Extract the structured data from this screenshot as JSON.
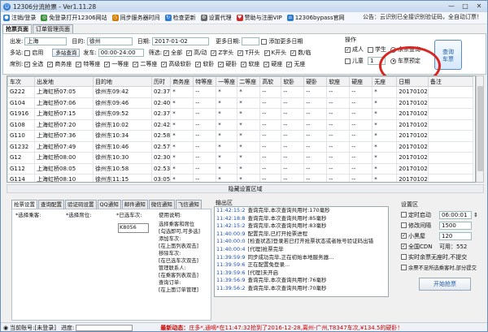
{
  "window": {
    "title": "12306分流抢票 - Ver1.11.28",
    "minimize": "—",
    "maximize": "□",
    "close": "✕"
  },
  "toolbar": {
    "items": [
      {
        "label": "注销/登录",
        "icon": "user-icon",
        "color": "#2b7bd0"
      },
      {
        "label": "免登录打开12306网站",
        "icon": "globe-icon",
        "color": "#3a8a3a"
      },
      {
        "label": "同步服务器时间",
        "icon": "clock-icon",
        "color": "#d07a00"
      },
      {
        "label": "检查更新",
        "icon": "update-icon",
        "color": "#2b7bd0"
      },
      {
        "label": "设置代理",
        "icon": "gear-icon",
        "color": "#666666"
      },
      {
        "label": "赞助与注册VIP",
        "icon": "heart-icon",
        "color": "#d02a2a"
      },
      {
        "label": "12306bypass官网",
        "icon": "home-icon",
        "color": "#2b7bd0"
      }
    ],
    "notice": "公告：云识别已全接识别验证码，全自动订票！"
  },
  "tabs": [
    {
      "label": "抢票页面"
    },
    {
      "label": "订单管理页面"
    }
  ],
  "search": {
    "from_label": "出发:",
    "from_value": "上海",
    "to_label": "目的:",
    "to_value": "徐州",
    "date_label": "日期:",
    "date_value": "2017-01-02",
    "more_dates_label": "更多日期:",
    "add_more_dates_label": "添加更多日期",
    "multistation_label": "多站:",
    "multistation_enable": "启用",
    "multistation_button": "多站查询",
    "depart_label": "发车:",
    "depart_value": "00:00-24:00",
    "filter_label": "筛选:",
    "filters": [
      {
        "label": "全部",
        "checked": true
      },
      {
        "label": "高/动",
        "checked": true
      },
      {
        "label": "Z字头",
        "checked": true
      },
      {
        "label": "T开头",
        "checked": true
      },
      {
        "label": "K开头",
        "checked": true
      },
      {
        "label": "数/临",
        "checked": true
      }
    ],
    "seat_label": "席别:",
    "seats": [
      {
        "label": "全选",
        "checked": true
      },
      {
        "label": "商务座",
        "checked": true
      },
      {
        "label": "特等座",
        "checked": true
      },
      {
        "label": "一等座",
        "checked": true
      },
      {
        "label": "二等座",
        "checked": true
      },
      {
        "label": "高级软卧",
        "checked": true
      },
      {
        "label": "软卧",
        "checked": true
      },
      {
        "label": "硬卧",
        "checked": true
      },
      {
        "label": "软座",
        "checked": true
      },
      {
        "label": "硬座",
        "checked": true
      },
      {
        "label": "无座",
        "checked": true
      }
    ]
  },
  "operation": {
    "label": "操作",
    "adult": "成人",
    "student": "学生",
    "child": "儿童",
    "child_count": "1",
    "remain_query": "余票查询",
    "schedule_booking": "车票预定",
    "query_button": "查询\n车票"
  },
  "table": {
    "headers": [
      "车次",
      "出发地",
      "目的地",
      "历时",
      "商务座",
      "特等座",
      "一等座",
      "二等座",
      "高软",
      "软卧",
      "硬卧",
      "软座",
      "硬座",
      "无座",
      "日期",
      "备注"
    ],
    "rows": [
      [
        "G222",
        "上海虹桥07:05",
        "徐州东09:42",
        "02:37",
        "*",
        "--",
        "*",
        "*",
        "--",
        "--",
        "--",
        "--",
        "--",
        "*",
        "20170102",
        ""
      ],
      [
        "G104",
        "上海虹桥07:06",
        "徐州东09:46",
        "02:40",
        "*",
        "--",
        "*",
        "*",
        "--",
        "--",
        "--",
        "--",
        "--",
        "*",
        "20170102",
        ""
      ],
      [
        "G1916",
        "上海虹桥07:15",
        "徐州东09:52",
        "02:37",
        "*",
        "--",
        "*",
        "*",
        "--",
        "--",
        "--",
        "--",
        "--",
        "*",
        "20170102",
        ""
      ],
      [
        "G108",
        "上海虹桥07:20",
        "徐州东10:02",
        "02:42",
        "*",
        "--",
        "*",
        "*",
        "--",
        "--",
        "--",
        "--",
        "--",
        "*",
        "20170102",
        ""
      ],
      [
        "G110",
        "上海虹桥07:36",
        "徐州东10:34",
        "02:58",
        "*",
        "--",
        "*",
        "*",
        "--",
        "--",
        "--",
        "--",
        "--",
        "*",
        "20170102",
        ""
      ],
      [
        "G1232",
        "上海虹桥07:49",
        "徐州东10:46",
        "02:57",
        "*",
        "--",
        "*",
        "*",
        "--",
        "--",
        "--",
        "--",
        "--",
        "*",
        "20170102",
        ""
      ],
      [
        "G12",
        "上海虹桥08:00",
        "徐州东10:30",
        "02:30",
        "*",
        "--",
        "*",
        "*",
        "--",
        "--",
        "--",
        "--",
        "--",
        "*",
        "20170102",
        ""
      ],
      [
        "G112",
        "上海虹桥08:05",
        "徐州东10:58",
        "02:53",
        "*",
        "--",
        "*",
        "*",
        "--",
        "--",
        "--",
        "--",
        "--",
        "*",
        "20170102",
        ""
      ],
      [
        "G114",
        "上海虹桥08:10",
        "徐州东11:15",
        "03:05",
        "*",
        "--",
        "*",
        "*",
        "--",
        "--",
        "--",
        "--",
        "--",
        "*",
        "20170102",
        ""
      ]
    ]
  },
  "hide_settings": "隐藏设置区域",
  "bottom_tabs": [
    {
      "label": "抢票设置"
    },
    {
      "label": "查询配置"
    },
    {
      "label": "验证码设置"
    },
    {
      "label": "QQ通知"
    },
    {
      "label": "邮件通知"
    },
    {
      "label": "微信通知"
    },
    {
      "label": "飞信通知"
    }
  ],
  "booking": {
    "passenger_label": "*选择乘客:",
    "seat_label": "*选择席位:",
    "train_label": "*已选车次:",
    "train_value": "K8056",
    "usage_label": "使用说明:",
    "usage_lines": [
      "选择乘客和席位",
      "[勾选即可,可多选]",
      "添加车次:",
      "[在上面列表双击]",
      "移除车次:",
      "[在已选车次双击]",
      "管理联系人:",
      "[在乘客列表双击]",
      "查询订单:",
      "[在上面订单管理]"
    ]
  },
  "output": {
    "label": "输出区",
    "lines": [
      {
        "time": "11:42:15:2",
        "text": "查询完毕,本次查询共用时:170毫秒"
      },
      {
        "time": "11:42:18:8",
        "text": "查询完毕,本次查询共用时:85毫秒"
      },
      {
        "time": "11:42:15:2",
        "text": "查询完毕,本次查询共用时:83毫秒"
      },
      {
        "time": "11:40:00:9",
        "text": "配置完毕,已打开抢票进程"
      },
      {
        "time": "11:40:00:0",
        "text": "[检查状态]登录若已打开抢票状态或者账号验证码出错"
      },
      {
        "time": "11:40:00:4",
        "text": "[代理]抢票完毕"
      },
      {
        "time": "11:39:59:9",
        "text": "同步成功完毕,正在初始本地服务器..."
      },
      {
        "time": "11:39:59:6",
        "text": "正在配置免登录..."
      },
      {
        "time": "11:39:59:6",
        "text": "[代理]未开启"
      },
      {
        "time": "11:39:56:9",
        "text": "查询完毕,本次查询共用时:76毫秒"
      },
      {
        "time": "11:39:56:2",
        "text": "查询完毕,本次查询共用时:70毫秒"
      }
    ]
  },
  "settings": {
    "label": "设置区",
    "auto_start": "定时启动",
    "auto_start_value": "06:00:01",
    "interval": "修改间隔",
    "interval_value": "1500",
    "blacklist": "小黑屋",
    "blacklist_value": "120",
    "cdn": "全国CDN",
    "cdn_value": "可用：552",
    "no_seat_try": "实时余票无座时,不提交",
    "partial_submit": "余票不足所选乘客时,部分提交",
    "start_button": "开始抢票"
  },
  "status": {
    "account_label": "当前账号:",
    "account_value": "[未登录]",
    "progress_label": "进度:",
    "progress": 0.0,
    "news_label": "最新动态：",
    "news_text": "庄多*,通嘀*在11:47:32抢到了2016-12-28,离州-广州,T8347车次,¥134.5的硬卧！"
  }
}
